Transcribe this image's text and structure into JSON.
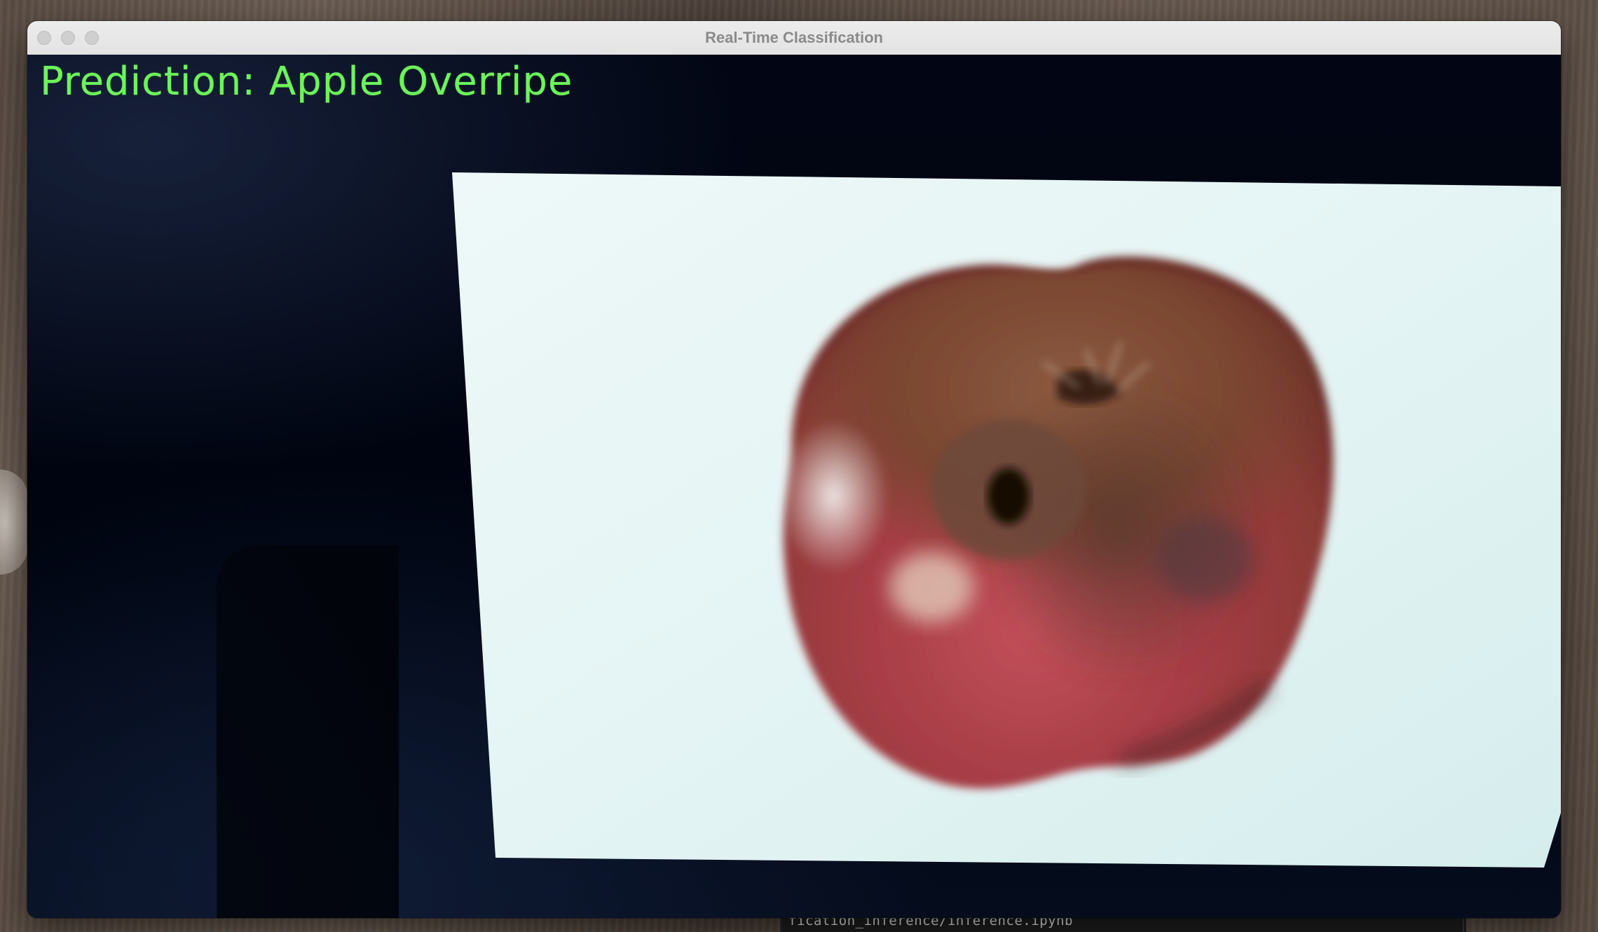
{
  "window": {
    "title": "Real-Time Classification",
    "traffic_lights": [
      "close",
      "minimize",
      "zoom"
    ]
  },
  "video": {
    "prediction_text": "Prediction: Apple Overripe",
    "overlay_color": "#6cf55a"
  },
  "background": {
    "terminal_text": "fication_inference/inference.ipynb"
  }
}
